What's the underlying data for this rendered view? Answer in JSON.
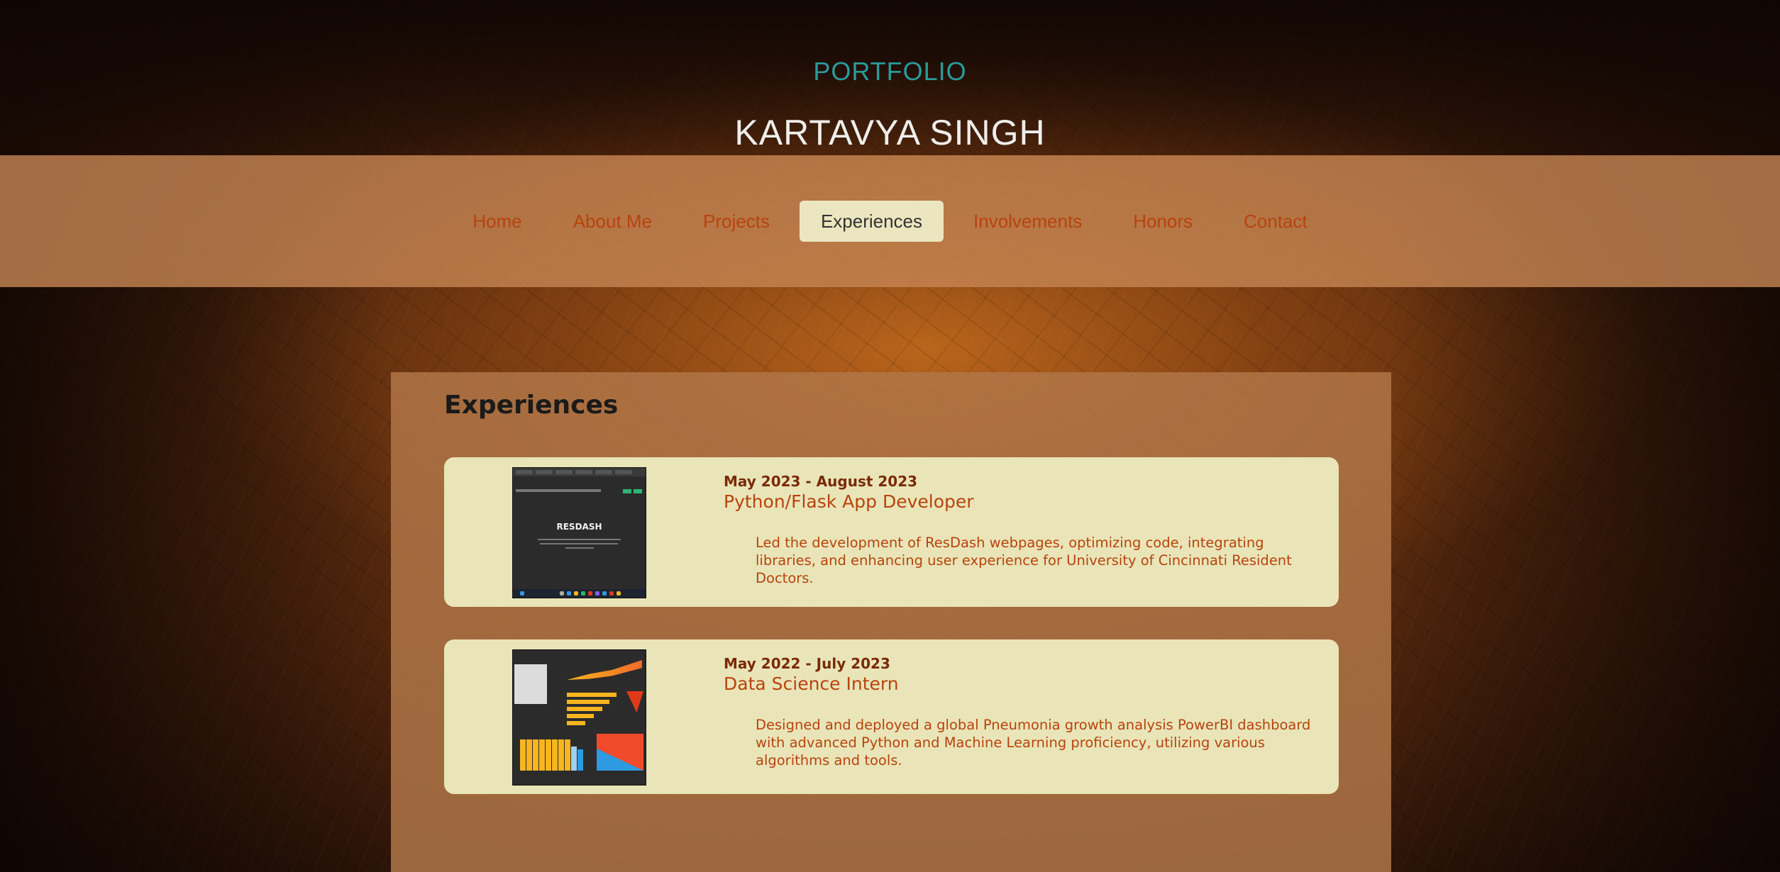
{
  "header": {
    "eyebrow": "PORTFOLIO",
    "name": "KARTAVYA SINGH"
  },
  "nav": {
    "items": [
      {
        "label": "Home"
      },
      {
        "label": "About Me"
      },
      {
        "label": "Projects"
      },
      {
        "label": "Experiences",
        "active": true
      },
      {
        "label": "Involvements"
      },
      {
        "label": "Honors"
      },
      {
        "label": "Contact"
      }
    ]
  },
  "main": {
    "title": "Experiences",
    "experiences": [
      {
        "dates": "May 2023 - August 2023",
        "role": "Python/Flask App Developer",
        "description": "Led the development of ResDash webpages, optimizing code, integrating libraries, and enhancing user experience for University of Cincinnati Resident Doctors.",
        "thumbnail_caption": "RESDASH"
      },
      {
        "dates": "May 2022 - July 2023",
        "role": "Data Science Intern",
        "description": "Designed and deployed a global Pneumonia growth analysis PowerBI dashboard with advanced Python and Machine Learning proficiency, utilizing various algorithms and tools."
      }
    ]
  },
  "colors": {
    "accent_teal": "#2a9a9a",
    "link_orange": "#b8430e",
    "card_bg": "#e9e5b8",
    "active_tab_bg": "#ebe6bf"
  }
}
